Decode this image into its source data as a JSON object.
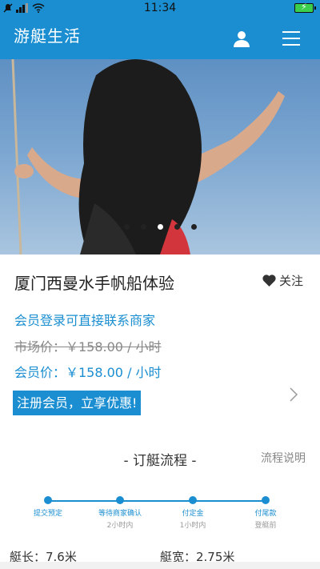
{
  "status_bar": {
    "time": "11:34"
  },
  "header": {
    "title": "游艇生活"
  },
  "carousel": {
    "active_index": 2,
    "slides": 5
  },
  "product": {
    "title": "厦门西曼水手帆船体验",
    "follow_label": "关注",
    "contact_notice": "会员登录可直接联系商家",
    "market_price": "市场价：￥158.00 / 小时",
    "member_price": "会员价：￥158.00 / 小时",
    "register_cta": "注册会员，立享优惠!"
  },
  "booking_process": {
    "title": "- 订艇流程 -",
    "link": "流程说明",
    "steps": [
      {
        "label": "提交预定",
        "sub": ""
      },
      {
        "label": "等待商家确认",
        "sub": "2小时内"
      },
      {
        "label": "付定金",
        "sub": "1小时内"
      },
      {
        "label": "付尾款",
        "sub": "登艇前"
      }
    ]
  },
  "specs": {
    "length": "艇长：7.6米",
    "width": "艇宽：2.75米"
  },
  "colors": {
    "brand": "#1a8ed0"
  }
}
